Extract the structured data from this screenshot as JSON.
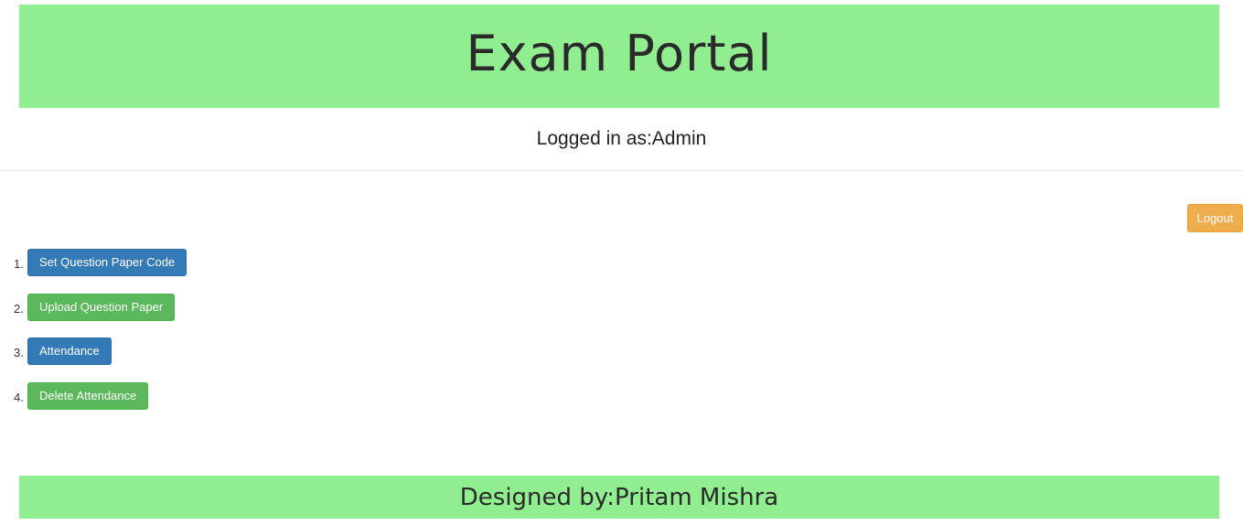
{
  "header": {
    "title": "Exam Portal"
  },
  "status": {
    "logged_in_text": "Logged in as:Admin"
  },
  "toolbar": {
    "logout_label": "Logout"
  },
  "actions": [
    {
      "number": "1.",
      "label": "Set Question Paper Code",
      "style": "primary"
    },
    {
      "number": "2.",
      "label": "Upload Question Paper",
      "style": "success"
    },
    {
      "number": "3.",
      "label": "Attendance",
      "style": "primary"
    },
    {
      "number": "4.",
      "label": "Delete Attendance",
      "style": "success"
    }
  ],
  "footer": {
    "text": "Designed by:Pritam Mishra"
  },
  "colors": {
    "banner": "#90ee90",
    "primary": "#337ab7",
    "success": "#5cb85c",
    "warning": "#f0ad4e"
  }
}
